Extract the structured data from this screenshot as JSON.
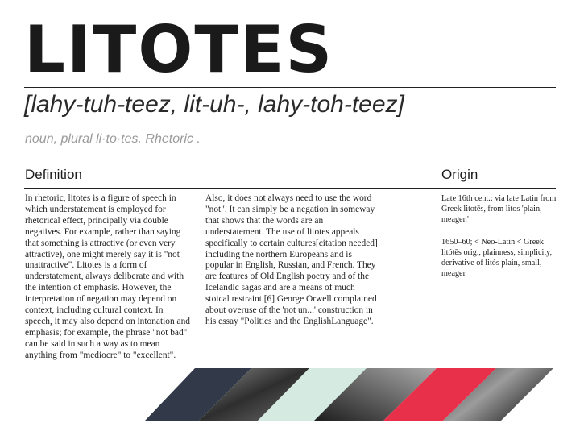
{
  "title": "LITOTES",
  "pronunciation": "[lahy-tuh-teez, lit-uh-, lahy-toh-teez]",
  "part_of_speech": "noun, plural li·to·tes. Rhetoric .",
  "definition": {
    "heading": "Definition",
    "column1": "In rhetoric, litotes is a figure of speech in which understatement is employed for rhetorical effect, principally via double negatives. For example, rather than saying that something is attractive (or even very attractive), one might merely say it is \"not unattractive\". Litotes is a form of understatement, always deliberate and with the intention of emphasis. However, the interpretation of negation may depend on context, including cultural context. In speech, it may also depend on intonation and emphasis; for example, the phrase \"not bad\" can be said in such a way as to mean anything from \"mediocre\" to \"excellent\".",
    "column2": "Also, it does not always need to use the word \"not\". It can simply be a negation in someway that shows that the words are an understatement. The use of litotes appeals specifically to certain cultures[citation needed] including the northern Europeans and is popular in English, Russian, and French. They are features of Old English poetry and of the Icelandic sagas and are a means of much stoical restraint.[6] George Orwell complained about overuse of the 'not un...' construction in his essay \"Politics and the EnglishLanguage\"."
  },
  "origin": {
    "heading": "Origin",
    "entry1": "Late 16th cent.: via late Latin from Greek litotēs, from litos 'plain, meager.'",
    "entry2": "1650–60; < Neo-Latin < Greek litótēs orig., plainness, simplicity, derivative of litós plain, small, meager"
  },
  "colors": {
    "ink": "#1a1a1a",
    "navy_stripe": "#323a49",
    "mint_stripe": "#d5ebe1",
    "red_stripe": "#e8304b",
    "muted_text": "#9a9a9a"
  }
}
